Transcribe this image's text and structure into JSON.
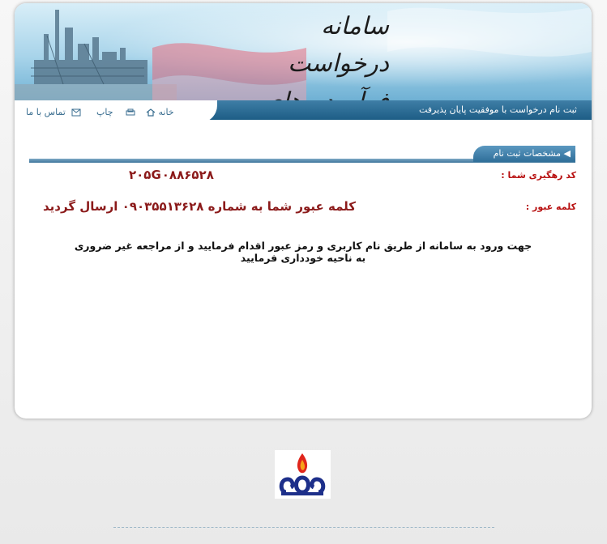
{
  "banner": {
    "title_line1": "سامانه درخواست",
    "title_line2": "فرآورده های نفتی"
  },
  "navbar": {
    "status": "ثبت نام درخواست با موفقیت پایان پذیرفت",
    "links": {
      "home": "خانه",
      "print": "چاپ",
      "contact": "تماس با ما"
    }
  },
  "section": {
    "title": "مشخصات ثبت نام"
  },
  "result": {
    "tracking_label": "کد رهگیری شما :",
    "tracking_value": "۲۰۵G۰۸۸۶۵۲۸",
    "password_label": "کلمه عبور :",
    "password_message": "کلمه عبور شما به شماره ۰۹۰۳۵۵۱۳۶۲۸ ارسال گردید",
    "instructions": "جهت ورود به سامانه از طریق نام کاربری و رمز عبور اقدام فرمایید و از مراجعه غیر ضروری به ناحیه خودداری فرمایید"
  },
  "colors": {
    "navbar": "#1d5d86",
    "label": "#b81010",
    "value": "#8b1a1a"
  }
}
